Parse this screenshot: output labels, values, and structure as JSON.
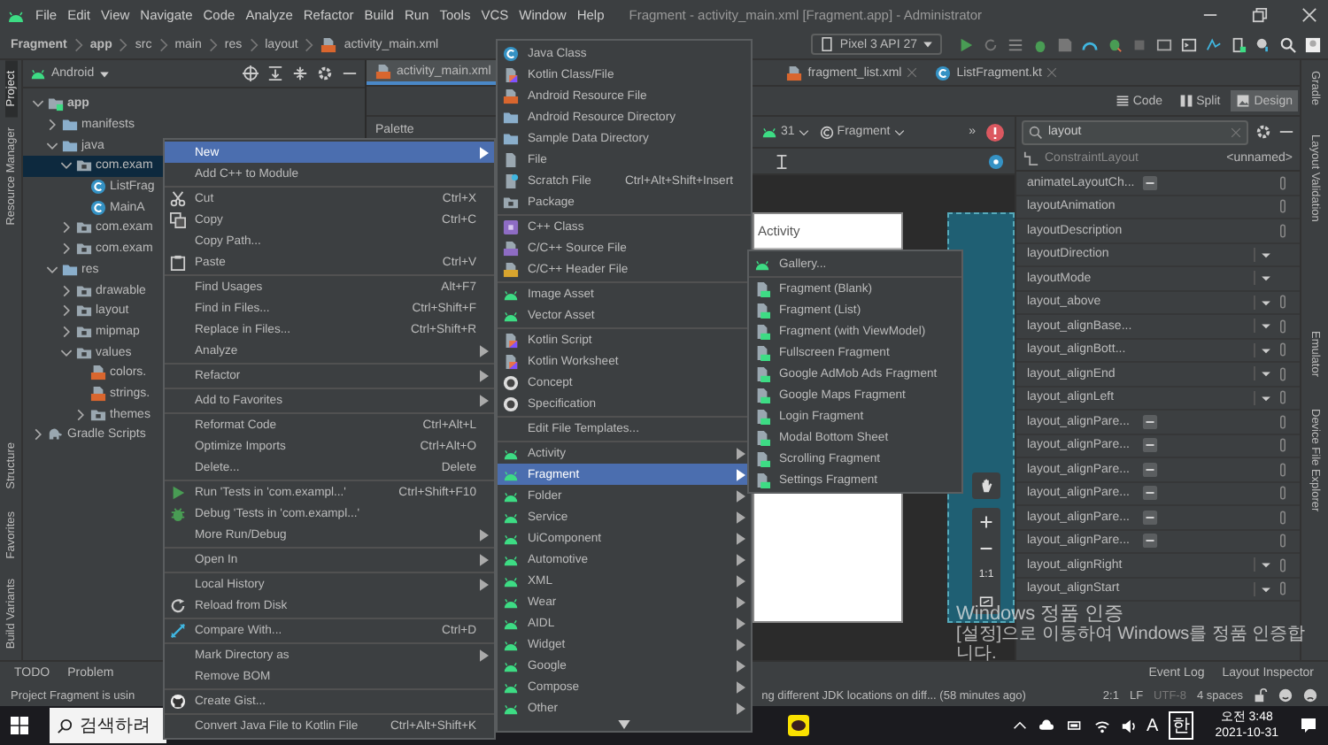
{
  "window": {
    "title": "Fragment - activity_main.xml [Fragment.app] - Administrator"
  },
  "menu_bar": [
    "File",
    "Edit",
    "View",
    "Navigate",
    "Code",
    "Analyze",
    "Refactor",
    "Build",
    "Run",
    "Tools",
    "VCS",
    "Window",
    "Help"
  ],
  "breadcrumbs": [
    {
      "label": "Fragment",
      "kind": "module"
    },
    {
      "label": "app",
      "kind": "module"
    },
    {
      "label": "src",
      "kind": "folder"
    },
    {
      "label": "main",
      "kind": "folder"
    },
    {
      "label": "res",
      "kind": "folder"
    },
    {
      "label": "layout",
      "kind": "folder"
    },
    {
      "label": "activity_main.xml",
      "kind": "file"
    }
  ],
  "device": "Pixel 3 API 27",
  "left_tool_tabs": [
    {
      "label": "Project",
      "selected": true
    },
    {
      "label": "Resource Manager",
      "selected": false
    }
  ],
  "left_bottom_tool_tabs": [
    {
      "label": "Structure",
      "selected": false
    },
    {
      "label": "Favorites",
      "selected": false
    },
    {
      "label": "Build Variants",
      "selected": false
    }
  ],
  "project_panel": {
    "view": "Android",
    "tree": [
      {
        "label": "app",
        "kind": "module",
        "expanded": true,
        "selected": false,
        "children": [
          {
            "label": "manifests",
            "kind": "folder",
            "expanded": false,
            "selected": false
          },
          {
            "label": "java",
            "kind": "folder",
            "expanded": true,
            "selected": false,
            "children": [
              {
                "label": "com.exam",
                "kind": "package",
                "expanded": true,
                "selected": true,
                "children": [
                  {
                    "label": "ListFrag",
                    "kind": "class",
                    "selected": false
                  },
                  {
                    "label": "MainA",
                    "kind": "class",
                    "selected": false
                  }
                ]
              },
              {
                "label": "com.exam",
                "kind": "package",
                "expanded": false,
                "selected": false
              },
              {
                "label": "com.exam",
                "kind": "package",
                "expanded": false,
                "selected": false
              }
            ]
          },
          {
            "label": "res",
            "kind": "folder",
            "expanded": true,
            "selected": false,
            "children": [
              {
                "label": "drawable",
                "kind": "package",
                "expanded": false,
                "selected": false
              },
              {
                "label": "layout",
                "kind": "package",
                "expanded": false,
                "selected": false
              },
              {
                "label": "mipmap",
                "kind": "package",
                "expanded": false,
                "selected": false
              },
              {
                "label": "values",
                "kind": "package",
                "expanded": true,
                "selected": false,
                "children": [
                  {
                    "label": "colors.",
                    "kind": "resource",
                    "selected": false
                  },
                  {
                    "label": "strings.",
                    "kind": "resource",
                    "selected": false
                  },
                  {
                    "label": "themes",
                    "kind": "package",
                    "expanded": false,
                    "selected": false
                  }
                ]
              }
            ]
          }
        ]
      },
      {
        "label": "Gradle Scripts",
        "kind": "gradle",
        "expanded": false,
        "selected": false
      }
    ]
  },
  "editor": {
    "tabs": [
      {
        "label": "activity_main.xml",
        "kind": "resource",
        "selected": true
      },
      {
        "label": "fragment_list.xml",
        "kind": "resource",
        "selected": false
      },
      {
        "label": "ListFragment.kt",
        "kind": "class",
        "selected": false
      }
    ],
    "view_modes": [
      {
        "label": "Code",
        "selected": false
      },
      {
        "label": "Split",
        "selected": false
      },
      {
        "label": "Design",
        "selected": true
      }
    ],
    "palette_title": "Palette",
    "api_level": "31",
    "theme": "Fragment",
    "overflow": "»",
    "preview_title": "Activity",
    "zoom_actual": "1:1"
  },
  "attributes": {
    "search": "layout",
    "component": "ConstraintLayout",
    "component_id": "<unnamed>",
    "rows": [
      {
        "name": "animateLayoutCh...",
        "kind": "flag"
      },
      {
        "name": "layoutAnimation",
        "kind": "text"
      },
      {
        "name": "layoutDescription",
        "kind": "text"
      },
      {
        "name": "layoutDirection",
        "kind": "enum"
      },
      {
        "name": "layoutMode",
        "kind": "enum"
      },
      {
        "name": "layout_above",
        "kind": "reference"
      },
      {
        "name": "layout_alignBase...",
        "kind": "reference"
      },
      {
        "name": "layout_alignBott...",
        "kind": "reference"
      },
      {
        "name": "layout_alignEnd",
        "kind": "reference"
      },
      {
        "name": "layout_alignLeft",
        "kind": "reference"
      },
      {
        "name": "layout_alignPare...",
        "kind": "flag"
      },
      {
        "name": "layout_alignPare...",
        "kind": "flag"
      },
      {
        "name": "layout_alignPare...",
        "kind": "flag"
      },
      {
        "name": "layout_alignPare...",
        "kind": "flag"
      },
      {
        "name": "layout_alignPare...",
        "kind": "flag"
      },
      {
        "name": "layout_alignPare...",
        "kind": "flag"
      },
      {
        "name": "layout_alignRight",
        "kind": "reference"
      },
      {
        "name": "layout_alignStart",
        "kind": "reference"
      }
    ]
  },
  "right_tool_tabs": [
    "Gradle",
    "Layout Validation",
    "Emulator",
    "Device File Explorer"
  ],
  "bottom_tool_tabs": [
    "TODO",
    "Problem"
  ],
  "bottom_tool_tabs_right": [
    "Event Log",
    "Layout Inspector"
  ],
  "status_bar": {
    "message_start": "Project Fragment is usin",
    "message_end": "ng different JDK locations on diff... (58 minutes ago)",
    "position": "2:1",
    "line_separator": "LF",
    "encoding": "UTF-8",
    "indent": "4 spaces"
  },
  "taskbar": {
    "search_placeholder": "검색하려",
    "ime_mode": "A",
    "ime_language": "한",
    "time": "오전 3:48",
    "date": "2021-10-31"
  },
  "activation_notice": {
    "title": "Windows 정품 인증",
    "message": "[설정]으로 이동하여 Windows를 정품 인증합니다."
  },
  "context_menu": {
    "groups": [
      [
        {
          "label": "New",
          "kind": "plain",
          "submenu": true,
          "selected": true
        },
        {
          "label": "Add C++ to Module",
          "kind": "plain",
          "submenu": false,
          "selected": false
        }
      ],
      [
        {
          "label": "Cut",
          "shortcut": "Ctrl+X",
          "kind": "scissors",
          "submenu": false,
          "selected": false
        },
        {
          "label": "Copy",
          "shortcut": "Ctrl+C",
          "kind": "copy",
          "submenu": false,
          "selected": false
        },
        {
          "label": "Copy Path...",
          "kind": "plain",
          "submenu": false,
          "selected": false
        },
        {
          "label": "Paste",
          "shortcut": "Ctrl+V",
          "kind": "paste",
          "submenu": false,
          "selected": false
        }
      ],
      [
        {
          "label": "Find Usages",
          "shortcut": "Alt+F7",
          "kind": "plain",
          "submenu": false,
          "selected": false
        },
        {
          "label": "Find in Files...",
          "shortcut": "Ctrl+Shift+F",
          "kind": "plain",
          "submenu": false,
          "selected": false
        },
        {
          "label": "Replace in Files...",
          "shortcut": "Ctrl+Shift+R",
          "kind": "plain",
          "submenu": false,
          "selected": false
        },
        {
          "label": "Analyze",
          "kind": "plain",
          "submenu": true,
          "selected": false
        }
      ],
      [
        {
          "label": "Refactor",
          "kind": "plain",
          "submenu": true,
          "selected": false
        }
      ],
      [
        {
          "label": "Add to Favorites",
          "kind": "plain",
          "submenu": true,
          "selected": false
        }
      ],
      [
        {
          "label": "Reformat Code",
          "shortcut": "Ctrl+Alt+L",
          "kind": "plain",
          "submenu": false,
          "selected": false
        },
        {
          "label": "Optimize Imports",
          "shortcut": "Ctrl+Alt+O",
          "kind": "plain",
          "submenu": false,
          "selected": false
        },
        {
          "label": "Delete...",
          "shortcut": "Delete",
          "kind": "plain",
          "submenu": false,
          "selected": false
        }
      ],
      [
        {
          "label": "Run 'Tests in 'com.exampl...'",
          "shortcut": "Ctrl+Shift+F10",
          "kind": "run",
          "submenu": false,
          "selected": false
        },
        {
          "label": "Debug 'Tests in 'com.exampl...'",
          "kind": "debug",
          "submenu": false,
          "selected": false
        },
        {
          "label": "More Run/Debug",
          "kind": "plain",
          "submenu": true,
          "selected": false
        }
      ],
      [
        {
          "label": "Open In",
          "kind": "plain",
          "submenu": true,
          "selected": false
        }
      ],
      [
        {
          "label": "Local History",
          "kind": "plain",
          "submenu": true,
          "selected": false
        },
        {
          "label": "Reload from Disk",
          "kind": "reload",
          "submenu": false,
          "selected": false
        }
      ],
      [
        {
          "label": "Compare With...",
          "shortcut": "Ctrl+D",
          "kind": "compare",
          "submenu": false,
          "selected": false
        }
      ],
      [
        {
          "label": "Mark Directory as",
          "kind": "plain",
          "submenu": true,
          "selected": false
        },
        {
          "label": "Remove BOM",
          "kind": "plain",
          "submenu": false,
          "selected": false
        }
      ],
      [
        {
          "label": "Create Gist...",
          "kind": "gist",
          "submenu": false,
          "selected": false
        }
      ],
      [
        {
          "label": "Convert Java File to Kotlin File",
          "shortcut": "Ctrl+Alt+Shift+K",
          "kind": "plain",
          "submenu": false,
          "selected": false
        }
      ]
    ]
  },
  "new_submenu": {
    "groups": [
      [
        {
          "label": "Java Class",
          "kind": "class",
          "submenu": false,
          "selected": false
        },
        {
          "label": "Kotlin Class/File",
          "kind": "kotlin",
          "submenu": false,
          "selected": false
        },
        {
          "label": "Android Resource File",
          "kind": "resource",
          "submenu": false,
          "selected": false
        },
        {
          "label": "Android Resource Directory",
          "kind": "folder",
          "submenu": false,
          "selected": false
        },
        {
          "label": "Sample Data Directory",
          "kind": "folder",
          "submenu": false,
          "selected": false
        },
        {
          "label": "File",
          "kind": "file",
          "submenu": false,
          "selected": false
        },
        {
          "label": "Scratch File",
          "shortcut": "Ctrl+Alt+Shift+Insert",
          "kind": "scratch",
          "submenu": false,
          "selected": false
        },
        {
          "label": "Package",
          "kind": "package",
          "submenu": false,
          "selected": false
        }
      ],
      [
        {
          "label": "C++ Class",
          "kind": "cpp",
          "submenu": false,
          "selected": false
        },
        {
          "label": "C/C++ Source File",
          "kind": "source",
          "submenu": false,
          "selected": false
        },
        {
          "label": "C/C++ Header File",
          "kind": "header",
          "submenu": false,
          "selected": false
        }
      ],
      [
        {
          "label": "Image Asset",
          "kind": "android",
          "submenu": false,
          "selected": false
        },
        {
          "label": "Vector Asset",
          "kind": "android",
          "submenu": false,
          "selected": false
        }
      ],
      [
        {
          "label": "Kotlin Script",
          "kind": "kotlin",
          "submenu": false,
          "selected": false
        },
        {
          "label": "Kotlin Worksheet",
          "kind": "kotlin",
          "submenu": false,
          "selected": false
        },
        {
          "label": "Concept",
          "kind": "concept",
          "submenu": false,
          "selected": false
        },
        {
          "label": "Specification",
          "kind": "concept",
          "submenu": false,
          "selected": false
        }
      ],
      [
        {
          "label": "Edit File Templates...",
          "kind": "plain",
          "submenu": false,
          "selected": false
        }
      ],
      [
        {
          "label": "Activity",
          "kind": "android",
          "submenu": true,
          "selected": false
        },
        {
          "label": "Fragment",
          "kind": "android",
          "submenu": true,
          "selected": true
        },
        {
          "label": "Folder",
          "kind": "android",
          "submenu": true,
          "selected": false
        },
        {
          "label": "Service",
          "kind": "android",
          "submenu": true,
          "selected": false
        },
        {
          "label": "UiComponent",
          "kind": "android",
          "submenu": true,
          "selected": false
        },
        {
          "label": "Automotive",
          "kind": "android",
          "submenu": true,
          "selected": false
        },
        {
          "label": "XML",
          "kind": "android",
          "submenu": true,
          "selected": false
        },
        {
          "label": "Wear",
          "kind": "android",
          "submenu": true,
          "selected": false
        },
        {
          "label": "AIDL",
          "kind": "android",
          "submenu": true,
          "selected": false
        },
        {
          "label": "Widget",
          "kind": "android",
          "submenu": true,
          "selected": false
        },
        {
          "label": "Google",
          "kind": "android",
          "submenu": true,
          "selected": false
        },
        {
          "label": "Compose",
          "kind": "android",
          "submenu": true,
          "selected": false
        },
        {
          "label": "Other",
          "kind": "android",
          "submenu": true,
          "selected": false
        }
      ]
    ]
  },
  "fragment_submenu": {
    "groups": [
      [
        {
          "label": "Gallery...",
          "kind": "android",
          "submenu": false,
          "selected": false
        }
      ],
      [
        {
          "label": "Fragment (Blank)",
          "kind": "fragment",
          "submenu": false,
          "selected": false
        },
        {
          "label": "Fragment (List)",
          "kind": "fragment",
          "submenu": false,
          "selected": false
        },
        {
          "label": "Fragment (with ViewModel)",
          "kind": "fragment",
          "submenu": false,
          "selected": false
        },
        {
          "label": "Fullscreen Fragment",
          "kind": "fragment",
          "submenu": false,
          "selected": false
        },
        {
          "label": "Google AdMob Ads Fragment",
          "kind": "fragment",
          "submenu": false,
          "selected": false
        },
        {
          "label": "Google Maps Fragment",
          "kind": "fragment",
          "submenu": false,
          "selected": false
        },
        {
          "label": "Login Fragment",
          "kind": "fragment",
          "submenu": false,
          "selected": false
        },
        {
          "label": "Modal Bottom Sheet",
          "kind": "fragment",
          "submenu": false,
          "selected": false
        },
        {
          "label": "Scrolling Fragment",
          "kind": "fragment",
          "submenu": false,
          "selected": false
        },
        {
          "label": "Settings Fragment",
          "kind": "fragment",
          "submenu": false,
          "selected": false
        }
      ]
    ]
  }
}
